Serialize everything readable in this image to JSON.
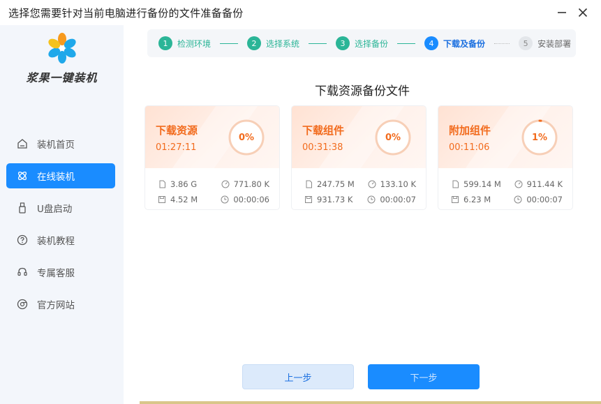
{
  "window": {
    "title": "选择您需要针对当前电脑进行备份的文件准备备份"
  },
  "brand": {
    "name": "浆果一键装机"
  },
  "sidebar": {
    "items": [
      {
        "label": "装机首页",
        "icon": "home-icon",
        "active": false
      },
      {
        "label": "在线装机",
        "icon": "atom-icon",
        "active": true
      },
      {
        "label": "U盘启动",
        "icon": "usb-icon",
        "active": false
      },
      {
        "label": "装机教程",
        "icon": "help-icon",
        "active": false
      },
      {
        "label": "专属客服",
        "icon": "headset-icon",
        "active": false
      },
      {
        "label": "官方网站",
        "icon": "browser-icon",
        "active": false
      }
    ]
  },
  "steps": [
    {
      "num": "1",
      "label": "检测环境",
      "state": "done"
    },
    {
      "num": "2",
      "label": "选择系统",
      "state": "done"
    },
    {
      "num": "3",
      "label": "选择备份",
      "state": "done"
    },
    {
      "num": "4",
      "label": "下载及备份",
      "state": "current"
    },
    {
      "num": "5",
      "label": "安装部署",
      "state": "todo"
    }
  ],
  "main": {
    "heading": "下载资源备份文件"
  },
  "cards": [
    {
      "name": "下载资源",
      "time": "01:27:11",
      "percent_label": "0%",
      "progress": 0,
      "size_total": "3.86 G",
      "speed": "771.80 K",
      "size_done": "4.52 M",
      "elapsed": "00:00:06"
    },
    {
      "name": "下载组件",
      "time": "00:31:38",
      "percent_label": "0%",
      "progress": 0,
      "size_total": "247.75 M",
      "speed": "133.10 K",
      "size_done": "931.73 K",
      "elapsed": "00:00:07"
    },
    {
      "name": "附加组件",
      "time": "00:11:06",
      "percent_label": "1%",
      "progress": 0.01,
      "size_total": "599.14 M",
      "speed": "911.44 K",
      "size_done": "6.23 M",
      "elapsed": "00:00:07"
    }
  ],
  "buttons": {
    "prev": "上一步",
    "next": "下一步"
  },
  "colors": {
    "accent": "#1a8cff",
    "done": "#2bb597",
    "orange": "#f26b1d"
  }
}
